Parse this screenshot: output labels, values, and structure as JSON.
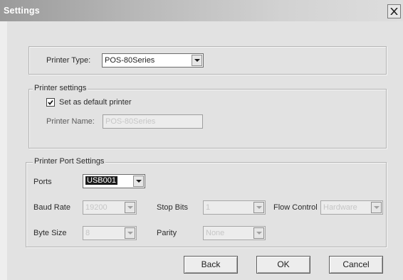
{
  "window": {
    "title": "Settings"
  },
  "printer": {
    "type_label": "Printer Type:",
    "type_value": "POS-80Series"
  },
  "printer_settings": {
    "group_label": "Printer settings",
    "default_label": "Set as default printer",
    "default_checked": true,
    "name_label": "Printer Name:",
    "name_value": "POS-80Series"
  },
  "port_settings": {
    "group_label": "Printer Port Settings",
    "ports_label": "Ports",
    "ports_value": "USB001",
    "baud_label": "Baud Rate",
    "baud_value": "19200",
    "stopbits_label": "Stop Bits",
    "stopbits_value": "1",
    "flow_label": "Flow Control",
    "flow_value": "Hardware",
    "bytesize_label": "Byte Size",
    "bytesize_value": "8",
    "parity_label": "Parity",
    "parity_value": "None"
  },
  "buttons": {
    "back": "Back",
    "ok": "OK",
    "cancel": "Cancel"
  }
}
